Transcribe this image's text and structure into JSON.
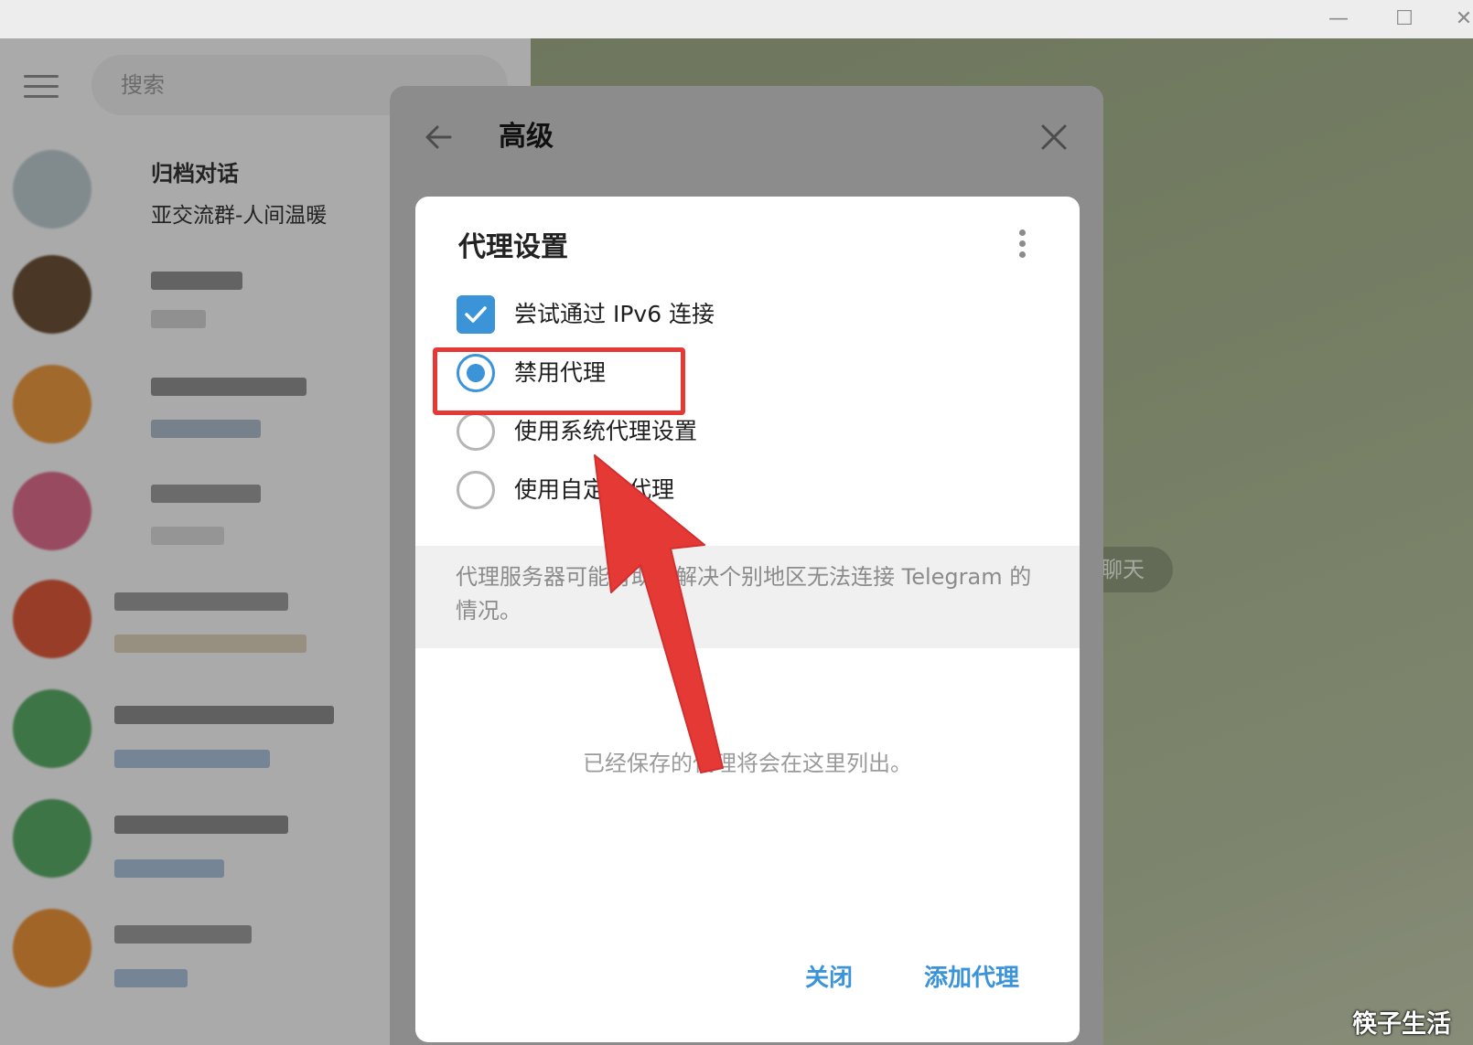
{
  "window": {
    "minimize_glyph": "—",
    "maximize_glyph": "☐",
    "close_glyph": "✕"
  },
  "sidebar": {
    "search_placeholder": "搜索",
    "chats": [
      {
        "title": "归档对话",
        "subtitle": "亚交流群-人间温暖"
      }
    ]
  },
  "chat_area": {
    "pill_label": "聊天"
  },
  "advanced_panel": {
    "title": "高级"
  },
  "proxy_dialog": {
    "title": "代理设置",
    "options": [
      {
        "label": "尝试通过 IPv6 连接",
        "type": "checkbox",
        "checked": true
      },
      {
        "label": "禁用代理",
        "type": "radio",
        "selected": true
      },
      {
        "label": "使用系统代理设置",
        "type": "radio",
        "selected": false
      },
      {
        "label": "使用自定义代理",
        "type": "radio",
        "selected": false
      }
    ],
    "info_text": "代理服务器可能有助于解决个别地区无法连接 Telegram 的情况。",
    "empty_text": "已经保存的代理将会在这里列出。",
    "close_button": "关闭",
    "add_button": "添加代理"
  },
  "colors": {
    "accent": "#3b93d8",
    "highlight": "#e53935"
  },
  "watermark": "筷子生活"
}
